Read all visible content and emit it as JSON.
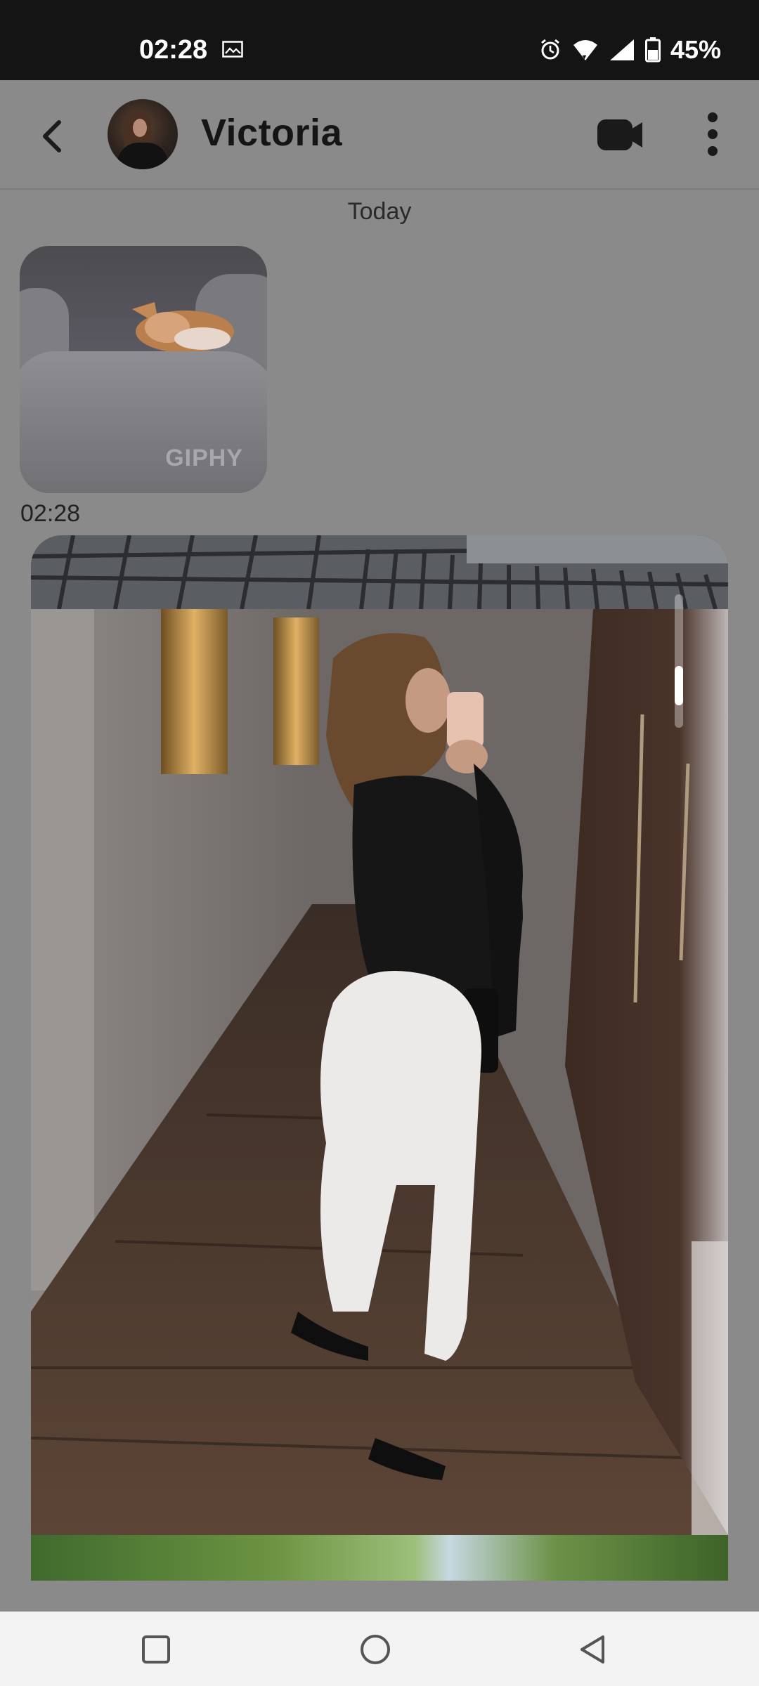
{
  "status_bar": {
    "time": "02:28",
    "battery": "45%",
    "icons": [
      "gallery-icon",
      "alarm-icon",
      "wifi-icon",
      "signal-icon",
      "battery-icon"
    ]
  },
  "header": {
    "contact_name": "Victoria",
    "icons": [
      "back-arrow-icon",
      "video-call-icon",
      "more-vert-icon"
    ]
  },
  "conversation": {
    "date_divider": "Today",
    "messages": [
      {
        "type": "gif",
        "badge": "GIPHY",
        "time": "02:28"
      },
      {
        "type": "image"
      }
    ]
  },
  "nav_bar": {
    "icons": [
      "recents-square-icon",
      "home-circle-icon",
      "back-triangle-icon"
    ]
  },
  "colors": {
    "status_bar_bg": "#141414",
    "dimmed_overlay": "#8a8a8a",
    "nav_bar_bg": "#f3f3f3"
  }
}
